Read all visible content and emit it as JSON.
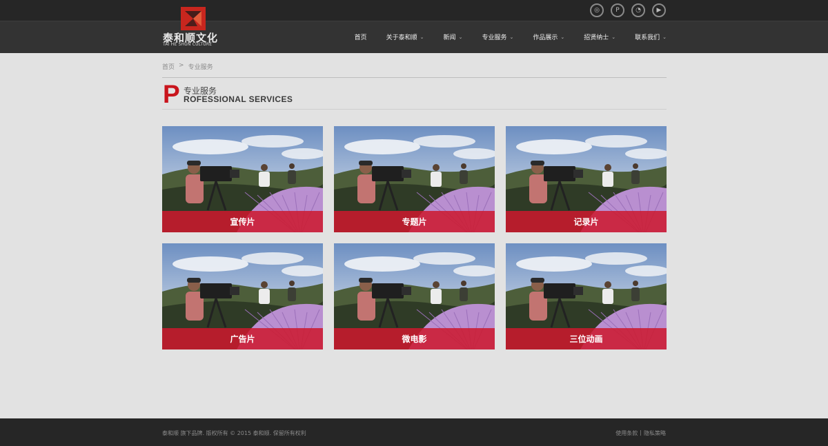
{
  "header": {
    "logo": {
      "cn": "泰和顺文化",
      "en": "TAI HE SHUN CULTURE"
    },
    "social": [
      {
        "icon": "weibo-icon",
        "glyph": "◎"
      },
      {
        "icon": "tencent-weibo-icon",
        "glyph": "P"
      },
      {
        "icon": "wechat-icon",
        "glyph": "◔"
      },
      {
        "icon": "video-play-icon",
        "glyph": "▶"
      }
    ],
    "nav": [
      {
        "label": "首页",
        "dropdown": false
      },
      {
        "label": "关于泰和顺",
        "dropdown": true
      },
      {
        "label": "新闻",
        "dropdown": true
      },
      {
        "label": "专业服务",
        "dropdown": true
      },
      {
        "label": "作品展示",
        "dropdown": true
      },
      {
        "label": "招贤纳士",
        "dropdown": true
      },
      {
        "label": "联系我们",
        "dropdown": true
      }
    ]
  },
  "breadcrumb": {
    "home": "首页",
    "sep": ">",
    "current": "专业服务"
  },
  "section": {
    "letter": "P",
    "title_cn": "专业服务",
    "title_en": "ROFESSIONAL SERVICES"
  },
  "services": [
    {
      "label": "宣传片"
    },
    {
      "label": "专题片"
    },
    {
      "label": "记录片"
    },
    {
      "label": "广告片"
    },
    {
      "label": "微电影"
    },
    {
      "label": "三位动画"
    }
  ],
  "footer": {
    "copyright": "泰和顺 旗下品牌. 版权所有 © 2015 泰和顺. 保留所有权利",
    "terms": "使用条款",
    "divider": "|",
    "privacy": "隐私策略"
  },
  "colors": {
    "accent": "#c9151d",
    "band": "#cd192d",
    "topbar": "#262626",
    "navbar": "#333333",
    "page": "#e2e2e2"
  }
}
